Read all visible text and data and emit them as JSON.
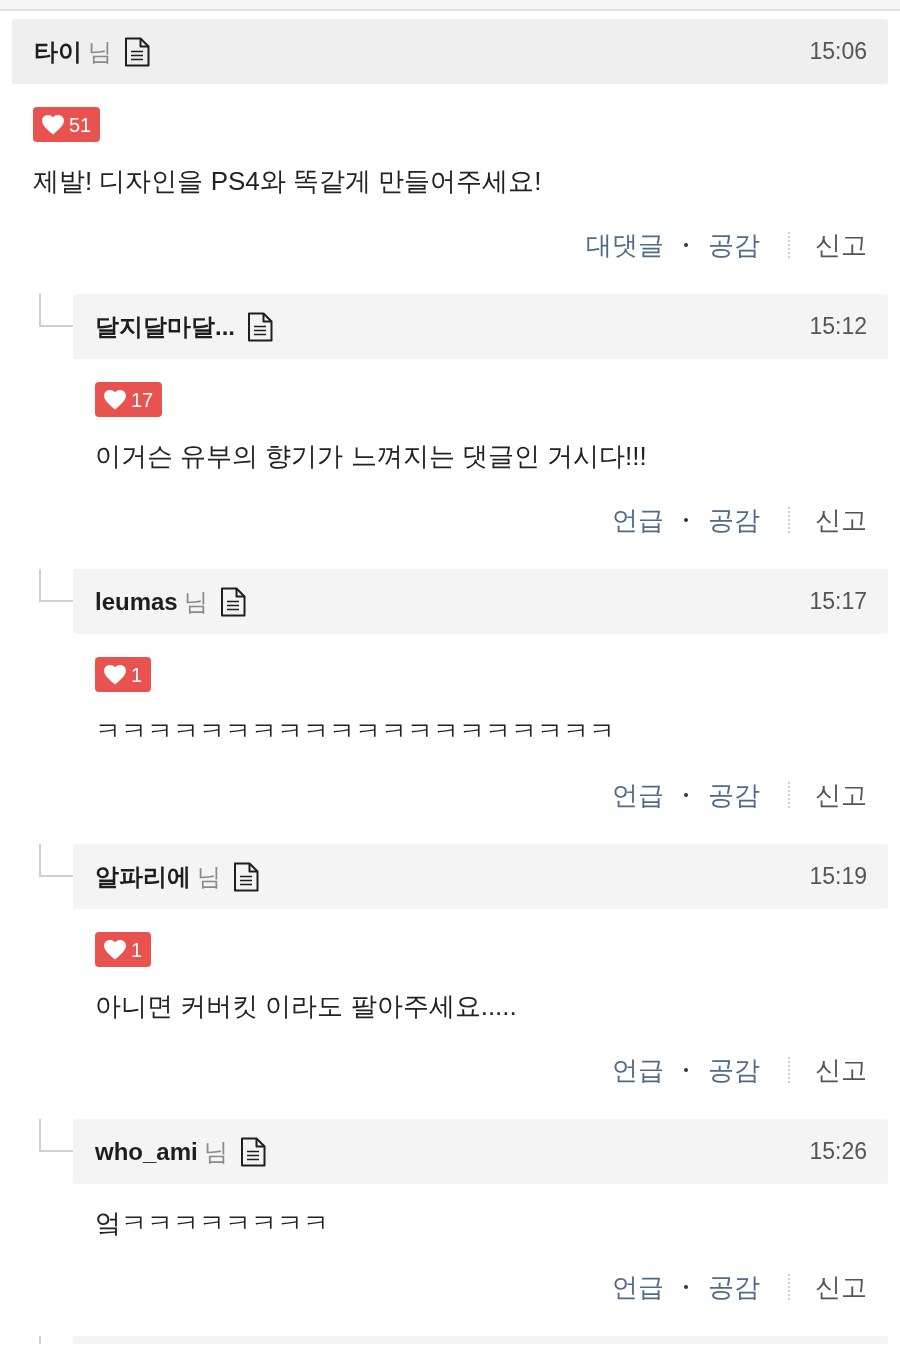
{
  "comments": [
    {
      "author": "타이",
      "honorific": "님",
      "time": "15:06",
      "likes": "51",
      "text": "제발! 디자인을 PS4와 똑같게 만들어주세요!",
      "actions": [
        {
          "label": "대댓글",
          "kind": "reply"
        },
        {
          "label": "공감",
          "kind": "like"
        },
        {
          "label": "신고",
          "kind": "report"
        }
      ],
      "replies": [
        {
          "author": "달지달마달...",
          "time": "15:12",
          "likes": "17",
          "text": "이거슨 유부의 향기가 느껴지는 댓글인 거시다!!!",
          "actions": [
            {
              "label": "언급",
              "kind": "mention"
            },
            {
              "label": "공감",
              "kind": "like"
            },
            {
              "label": "신고",
              "kind": "report"
            }
          ]
        },
        {
          "author": "leumas",
          "honorific": "님",
          "time": "15:17",
          "likes": "1",
          "text": "ㅋㅋㅋㅋㅋㅋㅋㅋㅋㅋㅋㅋㅋㅋㅋㅋㅋㅋㅋㅋ",
          "actions": [
            {
              "label": "언급",
              "kind": "mention"
            },
            {
              "label": "공감",
              "kind": "like"
            },
            {
              "label": "신고",
              "kind": "report"
            }
          ]
        },
        {
          "author": "알파리에",
          "honorific": "님",
          "time": "15:19",
          "likes": "1",
          "text": "아니면 커버킷 이라도 팔아주세요.....",
          "actions": [
            {
              "label": "언급",
              "kind": "mention"
            },
            {
              "label": "공감",
              "kind": "like"
            },
            {
              "label": "신고",
              "kind": "report"
            }
          ]
        },
        {
          "author": "who_ami",
          "honorific": "님",
          "time": "15:26",
          "text": "엌ㅋㅋㅋㅋㅋㅋㅋㅋ",
          "actions": [
            {
              "label": "언급",
              "kind": "mention"
            },
            {
              "label": "공감",
              "kind": "like"
            },
            {
              "label": "신고",
              "kind": "report"
            }
          ]
        }
      ]
    }
  ]
}
